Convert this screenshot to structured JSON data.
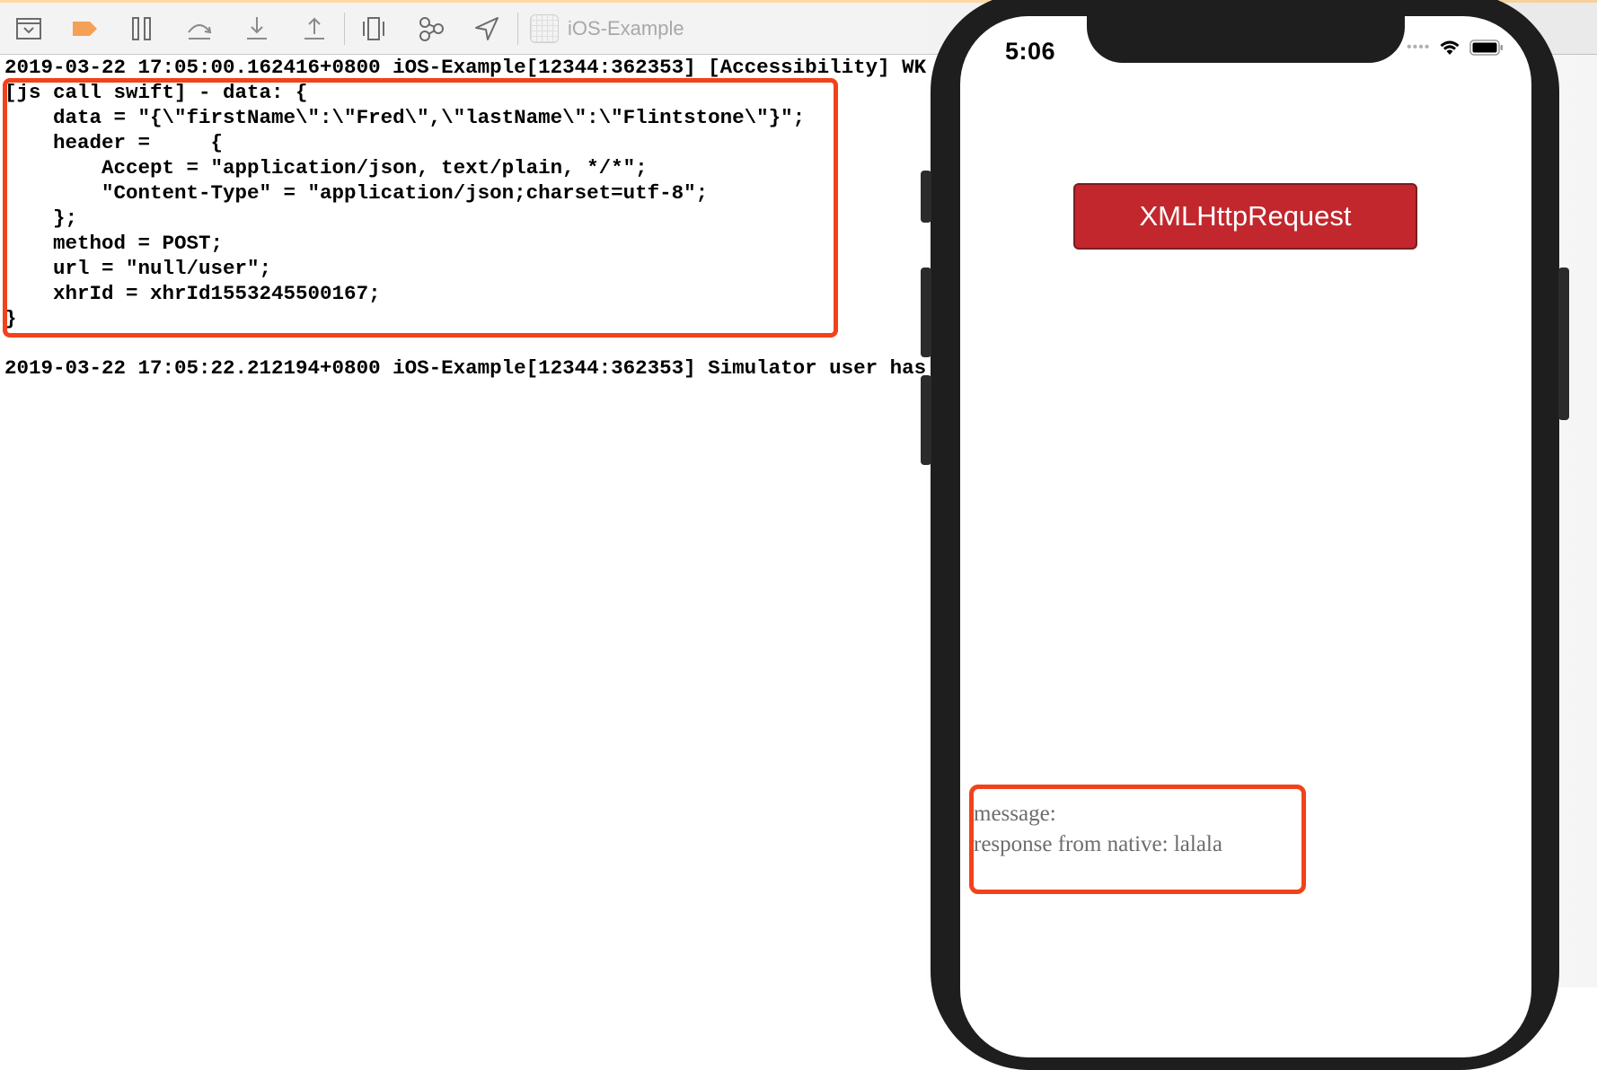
{
  "toolbar": {
    "buttons": [
      {
        "name": "hide-debug-area-button",
        "icon": "tray-down-icon"
      },
      {
        "name": "breakpoints-toggle-button",
        "icon": "breakpoint-icon",
        "color": "#f5a155"
      },
      {
        "name": "pause-button",
        "icon": "pause-icon"
      },
      {
        "name": "step-over-button",
        "icon": "step-over-icon"
      },
      {
        "name": "step-into-button",
        "icon": "step-into-icon"
      },
      {
        "name": "step-out-button",
        "icon": "step-out-icon"
      },
      {
        "name": "view-hierarchy-button",
        "icon": "view-hierarchy-icon"
      },
      {
        "name": "memory-graph-button",
        "icon": "memory-graph-icon"
      },
      {
        "name": "simulate-location-button",
        "icon": "location-arrow-icon"
      }
    ],
    "scheme_label": "iOS-Example"
  },
  "console": {
    "line1": "2019-03-22 17:05:00.162416+0800 iOS-Example[12344:362353] [Accessibility] WK",
    "block": [
      "[js call swift] - data: {",
      "    data = \"{\\\"firstName\\\":\\\"Fred\\\",\\\"lastName\\\":\\\"Flintstone\\\"}\";",
      "    header =     {",
      "        Accept = \"application/json, text/plain, */*\";",
      "        \"Content-Type\" = \"application/json;charset=utf-8\";",
      "    };",
      "    method = POST;",
      "    url = \"null/user\";",
      "    xhrId = xhrId1553245500167;",
      "}"
    ],
    "line_last": "2019-03-22 17:05:22.212194+0800 iOS-Example[12344:362353] Simulator user has"
  },
  "simulator": {
    "status_time": "5:06",
    "xhr_button_label": "XMLHttpRequest",
    "message_label": "message:",
    "message_value": "response from native: lalala",
    "colors": {
      "button": "#c1272d",
      "highlight": "#f2421c",
      "device_frame": "#1e1e1e"
    }
  }
}
